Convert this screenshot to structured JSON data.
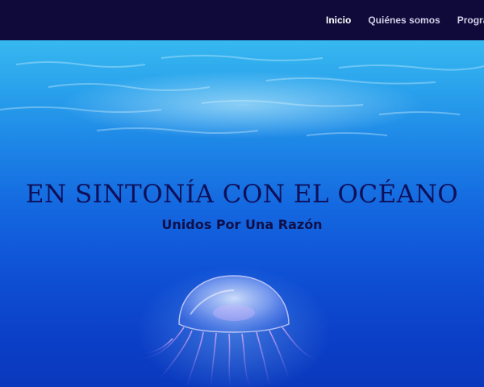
{
  "nav": {
    "items": [
      {
        "label": "Inicio",
        "active": true
      },
      {
        "label": "Quiénes somos",
        "active": false
      },
      {
        "label": "Programas",
        "active": false
      }
    ]
  },
  "hero": {
    "title": "EN SINTONÍA CON EL OCÉANO",
    "subtitle": "Unidos Por Una Razón",
    "image": "underwater-jellyfish-background"
  },
  "colors": {
    "topbar": "#0f0a3a",
    "title": "#0f0f5a",
    "water_top": "#37b8f0",
    "water_bottom": "#0a38bd"
  }
}
